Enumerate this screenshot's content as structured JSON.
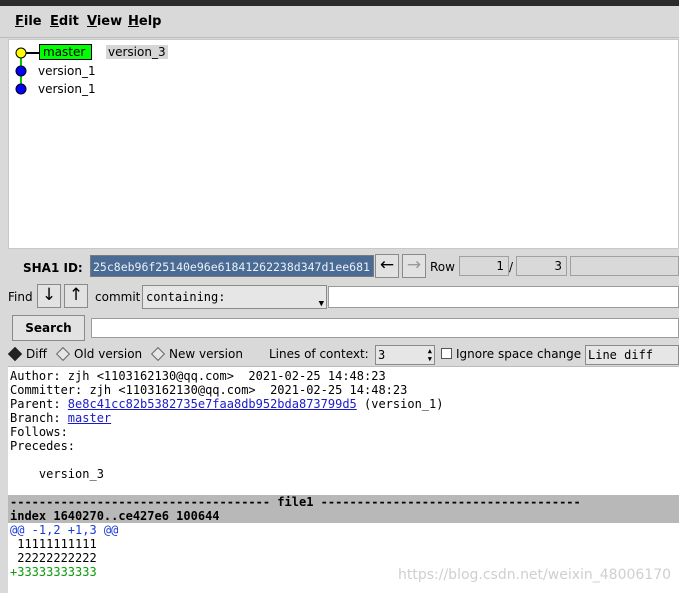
{
  "menu": {
    "file": "File",
    "edit": "Edit",
    "view": "View",
    "help": "Help"
  },
  "graph": {
    "refs": [
      {
        "label": "master",
        "color": "#00ff00"
      }
    ],
    "commits": [
      {
        "label": "version_3",
        "node_color": "#ffff00"
      },
      {
        "label": "version_1",
        "node_color": "#0000ff"
      },
      {
        "label": "version_1",
        "node_color": "#0000ff"
      }
    ],
    "line_color": "#00cc00"
  },
  "sha": {
    "label": "SHA1 ID:",
    "value": "25c8eb96f25140e96e61841262238d347d1ee681",
    "row_label": "Row",
    "row_current": "1",
    "row_sep": "/",
    "row_total": "3"
  },
  "find": {
    "label": "Find",
    "type": "commit",
    "mode": "containing:"
  },
  "search": {
    "button": "Search"
  },
  "options": {
    "diff": "Diff",
    "old_version": "Old version",
    "new_version": "New version",
    "context_label": "Lines of context:",
    "context_value": "3",
    "ignore_space": "Ignore space change",
    "diff_mode": "Line diff"
  },
  "details": {
    "author": "Author: zjh <1103162130@qq.com>  2021-02-25 14:48:23",
    "committer": "Committer: zjh <1103162130@qq.com>  2021-02-25 14:48:23",
    "parent_label": "Parent: ",
    "parent_hash": "8e8c41cc82b5382735e7faa8db952bda873799d5",
    "parent_desc": " (version_1)",
    "branch_label": "Branch: ",
    "branch_name": "master",
    "follows": "Follows:",
    "precedes": "Precedes:",
    "message": "    version_3",
    "file_header": "------------------------------------ file1 ------------------------------------",
    "index_line": "index 1640270..ce427e6 100644",
    "hunk": "@@ -1,2 +1,3 @@",
    "line1": " 11111111111",
    "line2": " 22222222222",
    "added": "+33333333333"
  },
  "watermark": "https://blog.csdn.net/weixin_48006170"
}
